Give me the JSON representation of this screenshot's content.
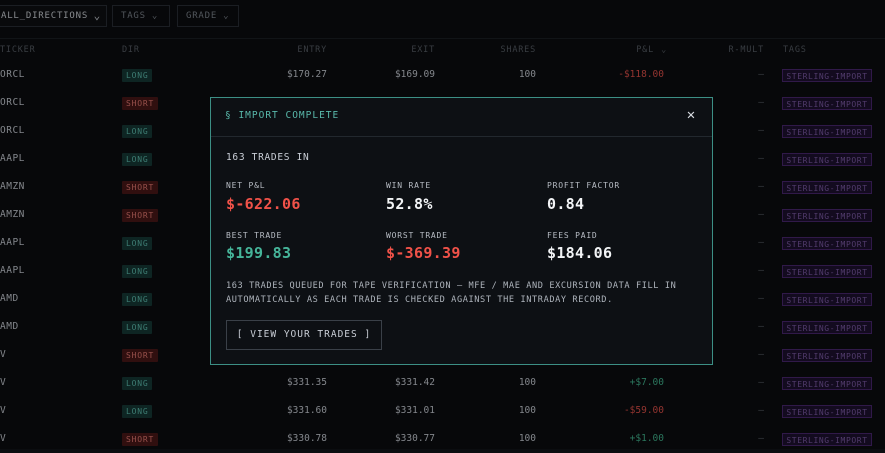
{
  "filters": {
    "direction": {
      "value": "ALL_DIRECTIONS",
      "icon": "chevron-down-icon"
    },
    "tags": {
      "label": "TAGS",
      "icon": "chevron-down-icon"
    },
    "grade": {
      "label": "GRADE",
      "icon": "chevron-down-icon"
    }
  },
  "table": {
    "columns": {
      "ticker": "TICKER",
      "dir": "DIR",
      "entry": "ENTRY",
      "exit": "EXIT",
      "shares": "SHARES",
      "pnl": "P&L",
      "pnl_sort": "⌄",
      "rmult": "R-MULT",
      "tags": "TAGS"
    },
    "rows": [
      {
        "ticker": "ORCL",
        "dir": "LONG",
        "entry": "$170.27",
        "exit": "$169.09",
        "shares": "100",
        "pnl": "-$118.00",
        "rmult": "—",
        "tag": "STERLING-IMPORT"
      },
      {
        "ticker": "ORCL",
        "dir": "SHORT",
        "entry": "",
        "exit": "",
        "shares": "",
        "pnl": "",
        "rmult": "—",
        "tag": "STERLING-IMPORT"
      },
      {
        "ticker": "ORCL",
        "dir": "LONG",
        "entry": "",
        "exit": "",
        "shares": "",
        "pnl": "",
        "rmult": "—",
        "tag": "STERLING-IMPORT"
      },
      {
        "ticker": "AAPL",
        "dir": "LONG",
        "entry": "",
        "exit": "",
        "shares": "",
        "pnl": "",
        "rmult": "—",
        "tag": "STERLING-IMPORT"
      },
      {
        "ticker": "AMZN",
        "dir": "SHORT",
        "entry": "",
        "exit": "",
        "shares": "",
        "pnl": "",
        "rmult": "—",
        "tag": "STERLING-IMPORT"
      },
      {
        "ticker": "AMZN",
        "dir": "SHORT",
        "entry": "",
        "exit": "",
        "shares": "",
        "pnl": "",
        "rmult": "—",
        "tag": "STERLING-IMPORT"
      },
      {
        "ticker": "AAPL",
        "dir": "LONG",
        "entry": "",
        "exit": "",
        "shares": "",
        "pnl": "",
        "rmult": "—",
        "tag": "STERLING-IMPORT"
      },
      {
        "ticker": "AAPL",
        "dir": "LONG",
        "entry": "",
        "exit": "",
        "shares": "",
        "pnl": "",
        "rmult": "—",
        "tag": "STERLING-IMPORT"
      },
      {
        "ticker": "AMD",
        "dir": "LONG",
        "entry": "",
        "exit": "",
        "shares": "",
        "pnl": "",
        "rmult": "—",
        "tag": "STERLING-IMPORT"
      },
      {
        "ticker": "AMD",
        "dir": "LONG",
        "entry": "",
        "exit": "",
        "shares": "",
        "pnl": "",
        "rmult": "—",
        "tag": "STERLING-IMPORT"
      },
      {
        "ticker": "V",
        "dir": "SHORT",
        "entry": "",
        "exit": "",
        "shares": "",
        "pnl": "",
        "rmult": "—",
        "tag": "STERLING-IMPORT"
      },
      {
        "ticker": "V",
        "dir": "LONG",
        "entry": "$331.35",
        "exit": "$331.42",
        "shares": "100",
        "pnl": "+$7.00",
        "rmult": "—",
        "tag": "STERLING-IMPORT"
      },
      {
        "ticker": "V",
        "dir": "LONG",
        "entry": "$331.60",
        "exit": "$331.01",
        "shares": "100",
        "pnl": "-$59.00",
        "rmult": "—",
        "tag": "STERLING-IMPORT"
      },
      {
        "ticker": "V",
        "dir": "SHORT",
        "entry": "$330.78",
        "exit": "$330.77",
        "shares": "100",
        "pnl": "+$1.00",
        "rmult": "—",
        "tag": "STERLING-IMPORT"
      }
    ]
  },
  "modal": {
    "title": "§ IMPORT COMPLETE",
    "close_icon": "close-icon",
    "count_text": "163 TRADES IN",
    "stats": [
      {
        "label": "NET P&L",
        "value": "$-622.06",
        "tone": "negative"
      },
      {
        "label": "WIN RATE",
        "value": "52.8%",
        "tone": "neutral"
      },
      {
        "label": "PROFIT FACTOR",
        "value": "0.84",
        "tone": "neutral"
      },
      {
        "label": "BEST TRADE",
        "value": "$199.83",
        "tone": "positive"
      },
      {
        "label": "WORST TRADE",
        "value": "$-369.39",
        "tone": "negative"
      },
      {
        "label": "FEES PAID",
        "value": "$184.06",
        "tone": "neutral"
      }
    ],
    "note": "163 TRADES QUEUED FOR TAPE VERIFICATION — MFE / MAE AND EXCURSION DATA FILL IN AUTOMATICALLY AS EACH TRADE IS CHECKED AGAINST THE INTRADAY RECORD.",
    "cta_label": "[ VIEW YOUR TRADES ]"
  },
  "colors": {
    "background": "#0b0d10",
    "accent": "#3c8f85",
    "negative": "#f05249",
    "positive": "#46b59a",
    "tag_purple": "#7d5ba6"
  }
}
